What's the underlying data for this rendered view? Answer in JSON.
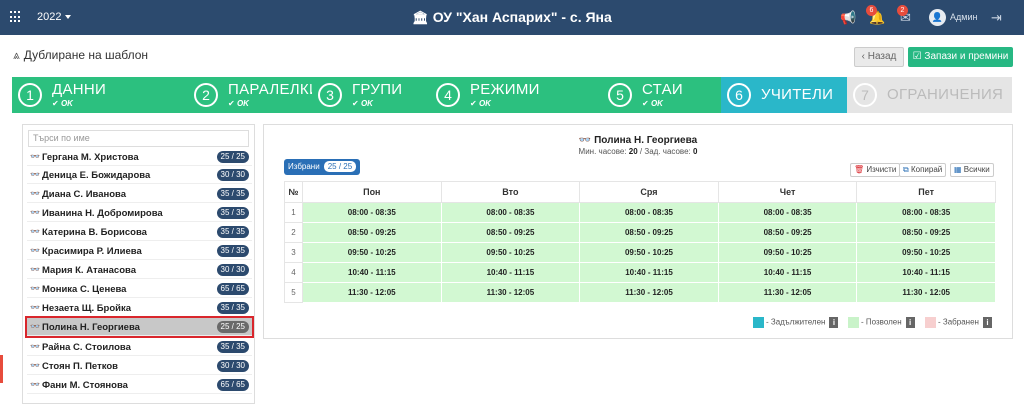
{
  "topbar": {
    "year": "2022",
    "title": "ОУ \"Хан Аспарих\" - с. Яна",
    "badge_notifications": "6",
    "badge_messages": "2",
    "user": "Админ"
  },
  "header": {
    "page_title": "Дублиране на шаблон",
    "back_label": "Назад",
    "save_label": "Запази и премини"
  },
  "steps": [
    {
      "num": "1",
      "name": "ДАННИ",
      "status": "OK"
    },
    {
      "num": "2",
      "name": "ПАРАЛЕЛКИ",
      "status": "OK"
    },
    {
      "num": "3",
      "name": "ГРУПИ",
      "status": "OK"
    },
    {
      "num": "4",
      "name": "РЕЖИМИ",
      "status": "OK"
    },
    {
      "num": "5",
      "name": "СТАИ",
      "status": "OK"
    },
    {
      "num": "6",
      "name": "УЧИТЕЛИ",
      "status": ""
    },
    {
      "num": "7",
      "name": "ОГРАНИЧЕНИЯ",
      "status": ""
    }
  ],
  "search": {
    "placeholder": "Търси по име"
  },
  "teachers": [
    {
      "name": "Гергана М. Христова",
      "count": "25 / 25"
    },
    {
      "name": "Деница Е. Божидарова",
      "count": "30 / 30"
    },
    {
      "name": "Диана С. Иванова",
      "count": "35 / 35"
    },
    {
      "name": "Иванина Н. Добромирова",
      "count": "35 / 35"
    },
    {
      "name": "Катерина В. Борисова",
      "count": "35 / 35"
    },
    {
      "name": "Красимира Р. Илиева",
      "count": "35 / 35"
    },
    {
      "name": "Мария К. Атанасова",
      "count": "30 / 30"
    },
    {
      "name": "Моника С. Ценева",
      "count": "65 / 65"
    },
    {
      "name": "Незаета Щ. Бройка",
      "count": "35 / 35"
    },
    {
      "name": "Полина Н. Георгиева",
      "count": "25 / 25"
    },
    {
      "name": "Райна С. Стоилова",
      "count": "35 / 35"
    },
    {
      "name": "Стоян П. Петков",
      "count": "30 / 30"
    },
    {
      "name": "Фани М. Стоянова",
      "count": "65 / 65"
    }
  ],
  "selected": {
    "name": "Полина Н. Георгиева",
    "min_label": "Мин. часове:",
    "min_value": "20",
    "sep": "/",
    "req_label": "Зад. часове:",
    "req_value": "0",
    "chosen_label": "Избрани",
    "chosen_count": "25 / 25"
  },
  "actions": {
    "clear": "Изчисти",
    "copy": "Копирай",
    "all": "Всички"
  },
  "schedule": {
    "num_header": "№",
    "days": [
      "Пон",
      "Вто",
      "Сря",
      "Чет",
      "Пет"
    ],
    "rows": [
      {
        "n": "1",
        "time": "08:00 - 08:35"
      },
      {
        "n": "2",
        "time": "08:50 - 09:25"
      },
      {
        "n": "3",
        "time": "09:50 - 10:25"
      },
      {
        "n": "4",
        "time": "10:40 - 11:15"
      },
      {
        "n": "5",
        "time": "11:30 - 12:05"
      }
    ]
  },
  "legend": {
    "required": "- Задължителен",
    "allowed": "- Позволен",
    "forbidden": "- Забранен",
    "colors": {
      "required": "#2ab7c9",
      "allowed": "#c9f3c9",
      "forbidden": "#f7cfcf"
    }
  },
  "colors": {
    "topbar": "#2c4a6e",
    "step_done": "#2cc07f",
    "step_active": "#2ab7c9",
    "step_pending": "#e5e5e5",
    "save": "#27b883"
  }
}
